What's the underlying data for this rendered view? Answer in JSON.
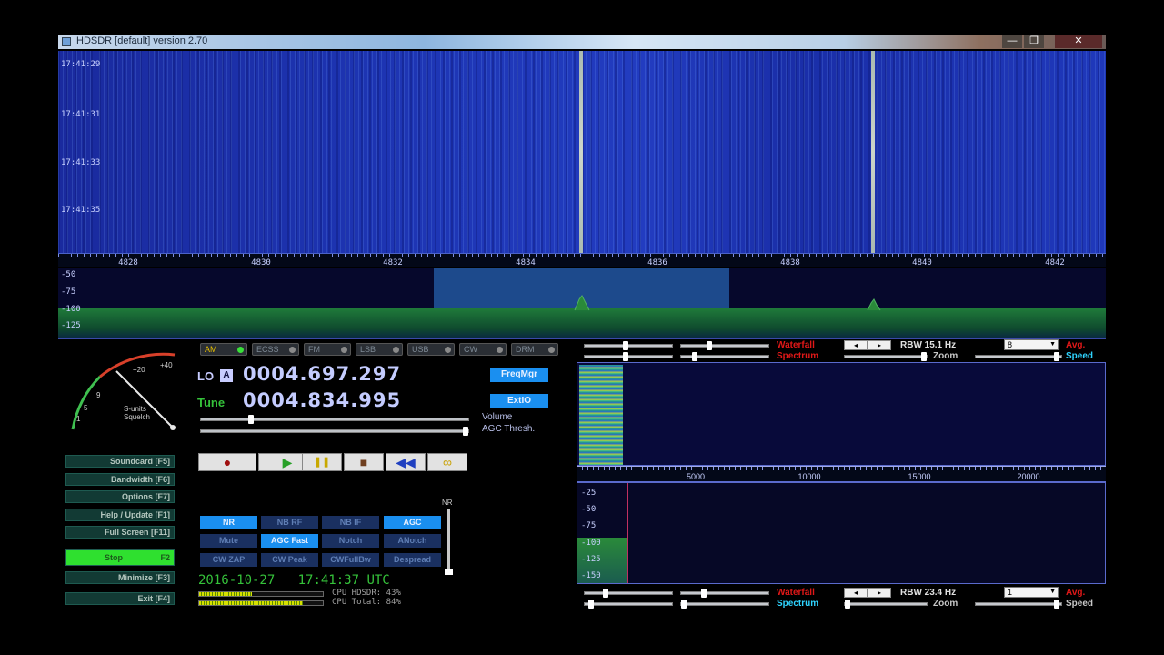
{
  "window": {
    "title": "HDSDR [default]  version 2.70",
    "min_glyph": "—",
    "max_glyph": "❐",
    "close_glyph": "✕"
  },
  "waterfall": {
    "time_labels": [
      "17:41:29",
      "17:41:31",
      "17:41:33",
      "17:41:35"
    ],
    "freq_labels": [
      "4828",
      "4830",
      "4832",
      "4834",
      "4836",
      "4838",
      "4840",
      "4842"
    ]
  },
  "spectrum": {
    "db_labels": [
      "-50",
      "-75",
      "-100",
      "-125"
    ]
  },
  "smeter": {
    "labels": [
      "+40",
      "+20",
      "9",
      "5",
      "1",
      "S-units",
      "Squelch"
    ]
  },
  "left_buttons": {
    "soundcard": "Soundcard [F5]",
    "bandwidth": "Bandwidth [F6]",
    "options": "Options [F7]",
    "help": "Help / Update [F1]",
    "fullscreen": "Full Screen [F11]",
    "stop_left": "Stop",
    "stop_right": "F2",
    "minimize": "Minimize [F3]",
    "exit": "Exit [F4]"
  },
  "modes": {
    "am": "AM",
    "ecss": "ECSS",
    "fm": "FM",
    "lsb": "LSB",
    "usb": "USB",
    "cw": "CW",
    "drm": "DRM"
  },
  "frequency": {
    "lo_label": "LO",
    "lo_sub": "A",
    "lo_value": "0004.697.297",
    "tune_label": "Tune",
    "tune_value": "0004.834.995",
    "freqmgr": "FreqMgr",
    "extio": "ExtIO"
  },
  "sliders": {
    "volume_label": "Volume",
    "agc_label": "AGC Thresh."
  },
  "transport": {
    "record": "●",
    "play": "▶",
    "pause": "❚❚",
    "stop": "■",
    "rewind": "◀◀",
    "loop": "∞"
  },
  "dsp": {
    "nr": "NR",
    "nb_rf": "NB RF",
    "nb_if": "NB IF",
    "agc": "AGC",
    "mute": "Mute",
    "agc_fast": "AGC Fast",
    "notch": "Notch",
    "anotch": "ANotch",
    "cw_zap": "CW ZAP",
    "cw_peak": "CW Peak",
    "cw_fullbw": "CWFullBw",
    "despread": "Despread",
    "nr_bar_label": "NR"
  },
  "status": {
    "date": "2016-10-27",
    "time": "17:41:37 UTC",
    "cpu_hdsdr_label": "CPU HDSDR:",
    "cpu_hdsdr_value": "43%",
    "cpu_total_label": "CPU Total:",
    "cpu_total_value": "84%",
    "cpu_hdsdr": 0.43,
    "cpu_total": 0.84
  },
  "rf_controls": {
    "waterfall": "Waterfall",
    "spectrum": "Spectrum",
    "rbw": "RBW 15.1 Hz",
    "zoom": "Zoom",
    "avg": "Avg.",
    "speed": "Speed",
    "avg_value": "8"
  },
  "af_scale": {
    "labels": [
      "5000",
      "10000",
      "15000",
      "20000"
    ]
  },
  "af_spectrum": {
    "db_labels": [
      "-25",
      "-50",
      "-75",
      "-100",
      "-125",
      "-150"
    ]
  },
  "af_controls": {
    "waterfall": "Waterfall",
    "spectrum": "Spectrum",
    "rbw": "RBW 23.4 Hz",
    "zoom": "Zoom",
    "avg": "Avg.",
    "speed": "Speed",
    "avg_value": "1"
  }
}
